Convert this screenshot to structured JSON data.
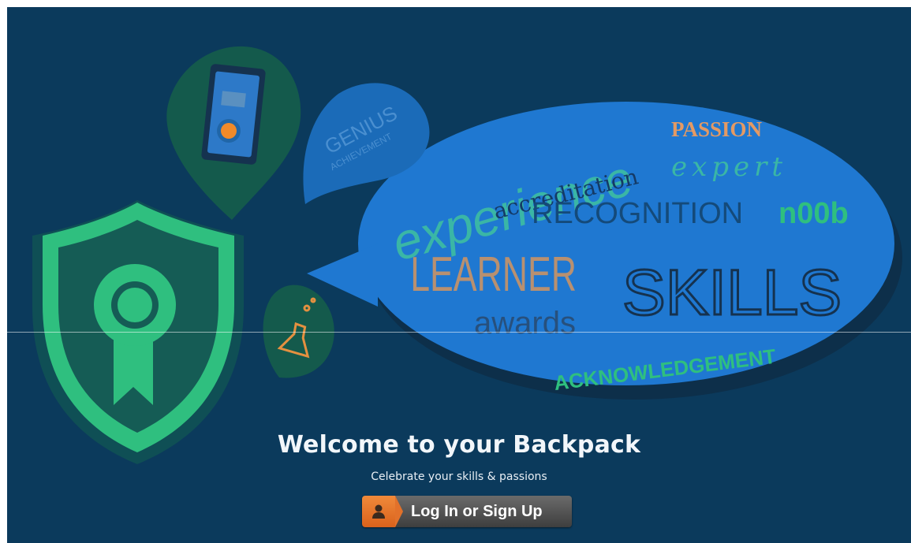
{
  "hero": {
    "cloud_words": {
      "experience": "experience",
      "passion": "PASSION",
      "accreditation": "accreditation",
      "expert": "expert",
      "recognition": "RECOGNITION",
      "noob": "n00b",
      "learner": "LEARNER",
      "skills": "SKILLS",
      "awards": "awards",
      "acknowledgement": "ACKNOWLEDGEMENT"
    },
    "small_bubble_words": {
      "genius": "GENIUS",
      "achievement": "ACHIEVEMENT"
    },
    "title": "Welcome to your Backpack",
    "subtitle": "Celebrate your skills & passions"
  },
  "login": {
    "label": "Log In or Sign Up"
  },
  "colors": {
    "background": "#0b3a5c",
    "speech_bubble": "#1f78d1",
    "badge_green": "#2fbf7f",
    "button_orange": "#e2712a",
    "button_gray": "#4a4a4a"
  },
  "icons": {
    "badge": "shield-ribbon-badge-icon",
    "phone": "mobile-phone-icon",
    "flask": "flask-icon",
    "person": "person-icon"
  }
}
